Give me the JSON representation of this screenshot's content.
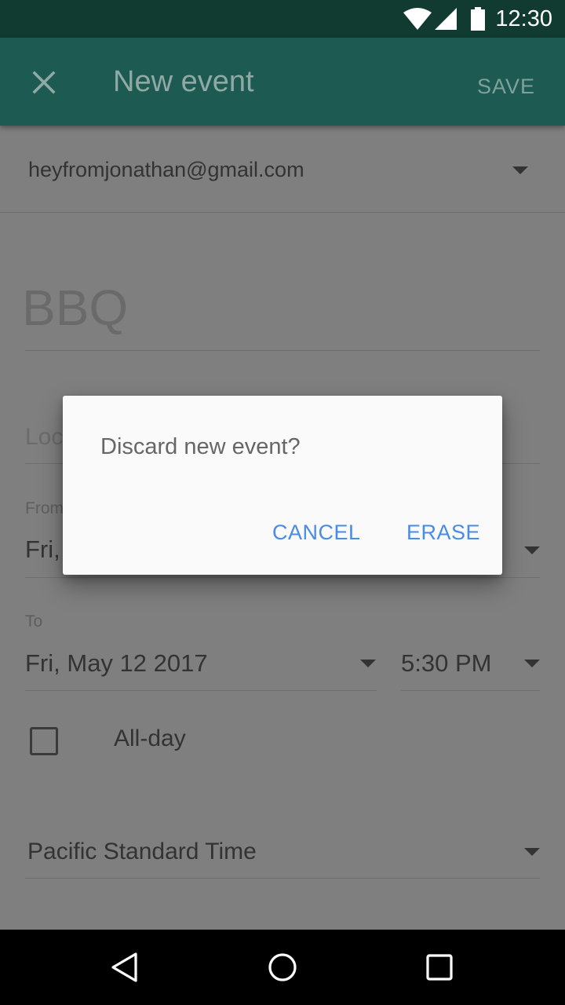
{
  "status_bar": {
    "time": "12:30",
    "icons": [
      "wifi-icon",
      "signal-icon",
      "battery-icon"
    ]
  },
  "app_bar": {
    "close_icon": "close-icon",
    "title": "New event",
    "save_label": "SAVE"
  },
  "form": {
    "account": "heyfromjonathan@gmail.com",
    "title_value": "BBQ",
    "location_partial": "Loc",
    "from": {
      "label": "From",
      "date_partial": "Fri,"
    },
    "to": {
      "label": "To",
      "date": "Fri, May 12 2017",
      "time": "5:30 PM"
    },
    "all_day_label": "All-day",
    "timezone": "Pacific Standard Time"
  },
  "dialog": {
    "message": "Discard new event?",
    "cancel_label": "CANCEL",
    "erase_label": "ERASE"
  },
  "nav_bar": {
    "icons": [
      "back-icon",
      "home-icon",
      "recents-icon"
    ]
  },
  "colors": {
    "status_bar": "#113a31",
    "app_bar": "#1d5a51",
    "scrim_bg": "#7f7f7f",
    "dialog_button": "#4a8be6"
  }
}
